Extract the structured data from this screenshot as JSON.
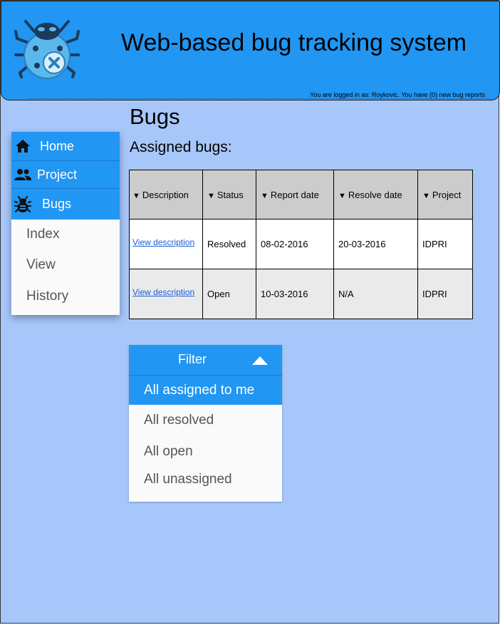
{
  "header": {
    "title": "Web-based bug tracking system",
    "login_status": "You are logged in as: Roykovic. You have (0) new bug reports",
    "logo_icon": "bug-logo-icon"
  },
  "sidebar": {
    "items": [
      {
        "label": "Home",
        "icon": "home-icon"
      },
      {
        "label": "Project",
        "icon": "people-icon"
      },
      {
        "label": "Bugs",
        "icon": "bug-icon"
      }
    ],
    "sub_items": [
      {
        "label": "Index"
      },
      {
        "label": "View"
      },
      {
        "label": "History"
      }
    ]
  },
  "main": {
    "page_title": "Bugs",
    "section_title": "Assigned bugs:",
    "table": {
      "columns": [
        "Description",
        "Status",
        "Report date",
        "Resolve date",
        "Project"
      ],
      "rows": [
        {
          "description": "View description",
          "status": "Resolved",
          "report_date": "08-02-2016",
          "resolve_date": "20-03-2016",
          "project": "IDPRI"
        },
        {
          "description": "View description",
          "status": "Open",
          "report_date": "10-03-2016",
          "resolve_date": "N/A",
          "project": "IDPRI"
        }
      ]
    }
  },
  "filter": {
    "label": "Filter",
    "options": [
      "All assigned to me",
      "All resolved",
      "All open",
      "All unassigned"
    ],
    "selected": "All assigned to me"
  },
  "colors": {
    "accent": "#2196f3",
    "background": "#a7c7fa",
    "header_row": "#cccccc",
    "alt_row": "#eaeaea",
    "link": "#1a5fd4"
  }
}
